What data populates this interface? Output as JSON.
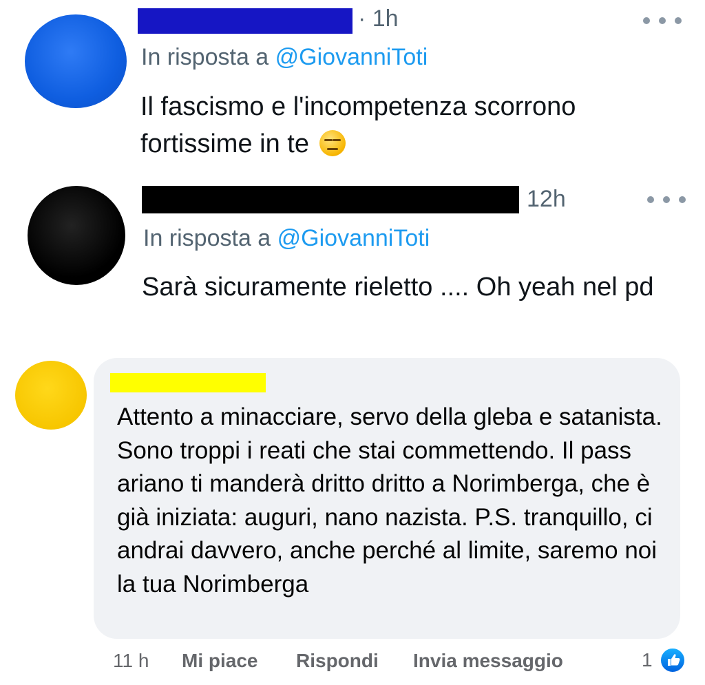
{
  "tweets": [
    {
      "time": "· 1h",
      "reply_prefix": "In risposta a ",
      "reply_handle": "@GiovanniToti",
      "text": "Il fascismo e l'incompetenza scorrono fortissime in te",
      "emoji": "expressionless-face",
      "colors": {
        "avatar": "#1466e8",
        "redaction": "#1616c4"
      }
    },
    {
      "time": "12h",
      "reply_prefix": "In risposta a ",
      "reply_handle": "@GiovanniToti",
      "text": "Sarà sicuramente rieletto .... Oh yeah nel pd",
      "colors": {
        "avatar": "#000000",
        "redaction": "#000000"
      }
    }
  ],
  "fb_comment": {
    "text": "Attento a minacciare, servo della gleba e satanista. Sono troppi i reati che stai commettendo. Il pass ariano ti manderà dritto dritto a Norimberga, che è già iniziata: auguri, nano nazista. P.S. tranquillo, ci andrai davvero, anche perché al limite, saremo noi la tua Norimberga",
    "time": "11 h",
    "like_label": "Mi piace",
    "reply_label": "Rispondi",
    "message_label": "Invia messaggio",
    "like_count": "1",
    "colors": {
      "avatar": "#fcd000",
      "redaction": "#ffff00",
      "bubble": "#f0f2f5",
      "like_icon": "#1877f2"
    }
  },
  "colors": {
    "link": "#1d9bf0",
    "secondary_text": "#536471"
  }
}
